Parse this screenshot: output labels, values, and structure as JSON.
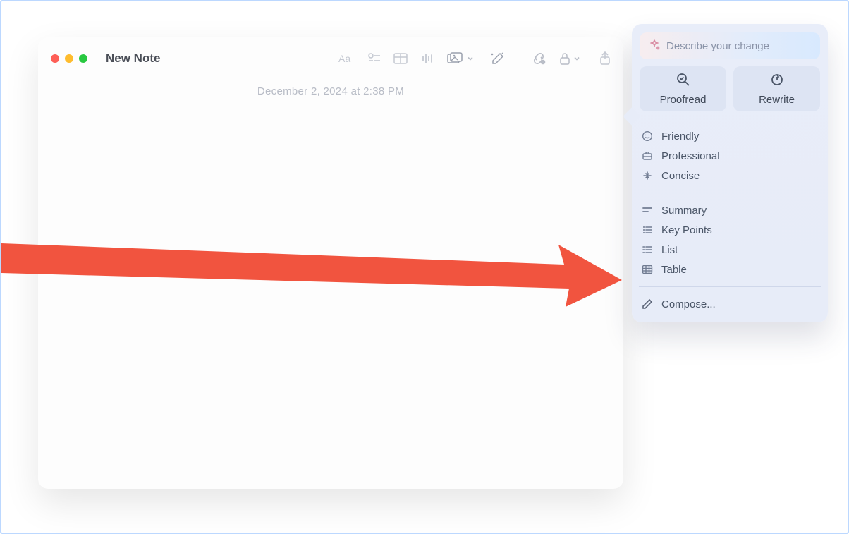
{
  "window": {
    "title": "New Note",
    "timestamp": "December 2, 2024 at 2:38 PM"
  },
  "popover": {
    "search_placeholder": "Describe your change",
    "buttons": {
      "proofread": "Proofread",
      "rewrite": "Rewrite"
    },
    "tone_items": {
      "friendly": "Friendly",
      "professional": "Professional",
      "concise": "Concise"
    },
    "format_items": {
      "summary": "Summary",
      "keypoints": "Key Points",
      "list": "List",
      "table": "Table"
    },
    "compose": "Compose..."
  }
}
